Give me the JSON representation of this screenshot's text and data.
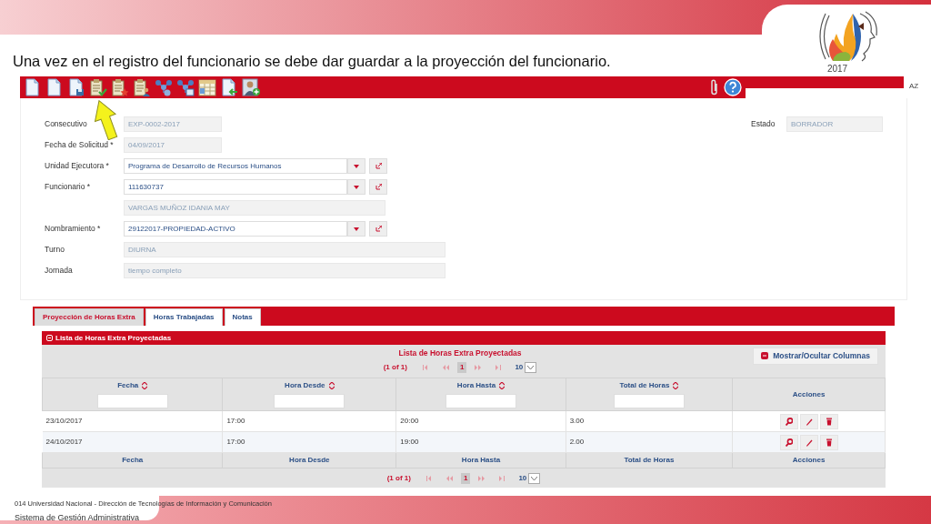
{
  "slide": {
    "caption": "Una vez en el registro del funcionario se debe dar guardar a la proyección del funcionario.",
    "logo_year": "2017",
    "footer_lines": [
      "014 Universidad Nacional - Dirección de Tecnologías de Información y Comunicación",
      "Sistema de Gestión Administrativa"
    ]
  },
  "app": {
    "toolbar": [
      {
        "kind": "page"
      },
      {
        "kind": "page"
      },
      {
        "kind": "page-disk"
      },
      {
        "kind": "clipboard-check"
      },
      {
        "kind": "clipboard-star"
      },
      {
        "kind": "clipboard-person"
      },
      {
        "kind": "nodes"
      },
      {
        "kind": "nodes-window"
      },
      {
        "kind": "calendar"
      },
      {
        "kind": "page-arrow"
      },
      {
        "kind": "person-plus"
      }
    ],
    "toolbar_right": [
      {
        "kind": "attach"
      },
      {
        "kind": "help"
      }
    ],
    "edge_text": "AZ",
    "form": {
      "rows": [
        {
          "label": "Consecutivo",
          "field": {
            "kind": "text-short",
            "value": "EXP-0002-2017"
          },
          "side": {
            "label": "Estado",
            "value": "BORRADOR"
          }
        },
        {
          "label": "Fecha de Solicitud *",
          "field": {
            "kind": "text-short",
            "value": "04/09/2017"
          }
        },
        {
          "label": "Unidad Ejecutora *",
          "field": {
            "kind": "select",
            "value": "Programa de Desarrollo de Recursos Humanos"
          }
        },
        {
          "label": "Funcionario *",
          "field": {
            "kind": "select",
            "value": "111630737"
          }
        },
        {
          "field": {
            "kind": "text-medium",
            "value": "VARGAS MUÑOZ IDANIA MAY"
          }
        },
        {
          "label": "Nombramiento *",
          "field": {
            "kind": "select",
            "value": "29122017-PROPIEDAD-ACTIVO"
          }
        },
        {
          "label": "Turno",
          "field": {
            "kind": "text-wide",
            "value": "DIURNA"
          }
        },
        {
          "label": "Jornada",
          "field": {
            "kind": "text-wide",
            "value": "tiempo completo"
          }
        }
      ]
    },
    "tabs": [
      {
        "label": "Proyección de Horas Extra",
        "selected": true
      },
      {
        "label": "Horas Trabajadas",
        "selected": false
      },
      {
        "label": "Notas",
        "selected": false
      }
    ],
    "panel": {
      "title": "Lista de Horas Extra Proyectadas",
      "table": {
        "caption": "Lista de Horas Extra Proyectadas",
        "toggle_button": "Mostrar/Ocultar Columnas",
        "paginator_top": {
          "report": "(1 of 1)",
          "pages": [
            {
              "label": "1",
              "selected": true
            }
          ],
          "rows_per_page": "10"
        },
        "columns": [
          {
            "label": "Fecha",
            "sortable": true,
            "filter": true
          },
          {
            "label": "Hora Desde",
            "sortable": true,
            "filter": true
          },
          {
            "label": "Hora Hasta",
            "sortable": true,
            "filter": true
          },
          {
            "label": "Total de Horas",
            "sortable": true,
            "filter": true
          },
          {
            "label": "Acciones",
            "sortable": false,
            "filter": false
          }
        ],
        "rows": [
          {
            "cells": [
              "23/10/2017",
              "17:00",
              "20:00",
              "3.00"
            ],
            "actions": [
              {
                "kind": "view"
              },
              {
                "kind": "edit"
              },
              {
                "kind": "delete"
              }
            ]
          },
          {
            "cells": [
              "24/10/2017",
              "17:00",
              "19:00",
              "2.00"
            ],
            "actions": [
              {
                "kind": "view"
              },
              {
                "kind": "edit"
              },
              {
                "kind": "delete"
              }
            ]
          }
        ],
        "footer_columns": [
          "Fecha",
          "Hora Desde",
          "Hora Hasta",
          "Total de Horas",
          "Acciones"
        ],
        "paginator_bottom": {
          "report": "(1 of 1)",
          "pages": [
            {
              "label": "1",
              "selected": true
            }
          ],
          "rows_per_page": "10"
        }
      }
    }
  }
}
